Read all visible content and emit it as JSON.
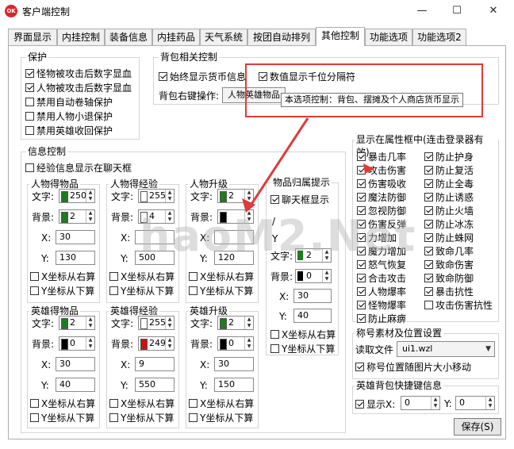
{
  "window": {
    "title": "客户端控制",
    "app_icon_text": "OK",
    "minimize": "—",
    "maximize": "☐",
    "close": "✕"
  },
  "tabs": [
    "界面显示",
    "内挂控制",
    "装备信息",
    "内挂药品",
    "天气系统",
    "按团自动排列",
    "其他控制",
    "功能选项",
    "功能选项2"
  ],
  "active_tab": "其他控制",
  "protect": {
    "title": "保护",
    "items": [
      {
        "label": "怪物被攻击后数字显血",
        "checked": true
      },
      {
        "label": "人物被攻击后数字显血",
        "checked": true
      },
      {
        "label": "禁用自动卷轴保护",
        "checked": false
      },
      {
        "label": "禁用人物小退保护",
        "checked": false
      },
      {
        "label": "禁用英雄收回保护",
        "checked": false
      }
    ]
  },
  "bag": {
    "title": "背包相关控制",
    "always_show_currency": {
      "label": "始终显示货币信息",
      "checked": true
    },
    "thousand_separator": {
      "label": "数值显示千位分隔符",
      "checked": true
    },
    "right_key_label": "背包右键操作:",
    "right_key_value": "人物英雄物品",
    "tooltip": "本选项控制：背包、摆摊及个人商店货币显示"
  },
  "info": {
    "title": "信息控制",
    "exp_in_chat": {
      "label": "经验信息显示在聊天框",
      "checked": false
    },
    "labels": {
      "text": "文字:",
      "bg": "背景:",
      "x": "X:",
      "y": "Y:",
      "x_right": "X坐标从右算",
      "y_bottom": "Y坐标从下算"
    },
    "blocks": [
      {
        "title": "人物得物品",
        "text_value": "250",
        "text_color": "#1e7b1e",
        "bg_value": "2",
        "bg_color": "#1e7b1e",
        "x": "30",
        "y": "130",
        "x_right": false,
        "y_bottom": false
      },
      {
        "title": "人物得经验",
        "text_value": "255",
        "text_color": "#ffffff",
        "bg_value": "4",
        "bg_color": "#ffffff",
        "x": "",
        "y": "500",
        "x_right": false,
        "y_bottom": false
      },
      {
        "title": "人物升级",
        "text_value": "2",
        "text_color": "#1e7b1e",
        "bg_value": "",
        "bg_color": "#000000",
        "x": "",
        "y": "120",
        "x_right": false,
        "y_bottom": false
      },
      {
        "title": "英雄得物品",
        "text_value": "2",
        "text_color": "#1e7b1e",
        "bg_value": "0",
        "bg_color": "#000000",
        "x": "30",
        "y": "40",
        "x_right": false,
        "y_bottom": false
      },
      {
        "title": "英雄得经验",
        "text_value": "255",
        "text_color": "#ffffff",
        "bg_value": "249",
        "bg_color": "#cc1010",
        "x": "9",
        "y": "550",
        "x_right": false,
        "y_bottom": false
      },
      {
        "title": "英雄升级",
        "text_value": "2",
        "text_color": "#1e7b1e",
        "bg_value": "0",
        "bg_color": "#000000",
        "x": "30",
        "y": "150",
        "x_right": false,
        "y_bottom": false
      }
    ],
    "item_owner": {
      "title": "物品归属提示",
      "chat_show": {
        "label": "聊天框显示",
        "checked": true
      },
      "text_value": "2",
      "text_color": "#1e7b1e",
      "bg_value": "0",
      "bg_color": "#000000",
      "x": "30",
      "y": "40",
      "x_right": false,
      "y_bottom": false
    }
  },
  "attr": {
    "title": "显示在属性框中(连击登录器有效)",
    "left": [
      {
        "label": "暴击几率",
        "checked": true
      },
      {
        "label": "攻击伤害",
        "checked": true
      },
      {
        "label": "伤害吸收",
        "checked": true
      },
      {
        "label": "魔法防御",
        "checked": true
      },
      {
        "label": "忽视防御",
        "checked": true
      },
      {
        "label": "伤害反弹",
        "checked": true
      },
      {
        "label": "力增加",
        "checked": true
      },
      {
        "label": "魔力增加",
        "checked": true
      },
      {
        "label": "怒气恢复",
        "checked": true
      },
      {
        "label": "合击攻击",
        "checked": true
      },
      {
        "label": "人物爆率",
        "checked": true
      },
      {
        "label": "怪物爆率",
        "checked": true
      },
      {
        "label": "防止麻痹",
        "checked": true
      }
    ],
    "right": [
      {
        "label": "防止护身",
        "checked": true
      },
      {
        "label": "防止复活",
        "checked": true
      },
      {
        "label": "防止全毒",
        "checked": true
      },
      {
        "label": "防止诱惑",
        "checked": true
      },
      {
        "label": "防止火墙",
        "checked": true
      },
      {
        "label": "防止冰冻",
        "checked": true
      },
      {
        "label": "防止蛛网",
        "checked": true
      },
      {
        "label": "致命几率",
        "checked": true
      },
      {
        "label": "致命伤害",
        "checked": true
      },
      {
        "label": "致命防御",
        "checked": true
      },
      {
        "label": "暴击抗性",
        "checked": true
      },
      {
        "label": "攻击伤害抗性",
        "checked": false
      }
    ]
  },
  "title_material": {
    "title": "称号素材及位置设置",
    "read_label": "读取文件",
    "file": "ui1.wzl",
    "move_with_pic": {
      "label": "称号位置随图片大小移动",
      "checked": true
    }
  },
  "hero_bag": {
    "title": "英雄背包快捷键信息",
    "show": {
      "label": "显示X:",
      "checked": true
    },
    "x": "0",
    "y_label": "Y:",
    "y": "0"
  },
  "save_button": "保存(S)",
  "watermark": "haoM2.Net",
  "colors": {
    "highlight": "#e03a3a",
    "annotation_arrow": "#e03a3a"
  }
}
